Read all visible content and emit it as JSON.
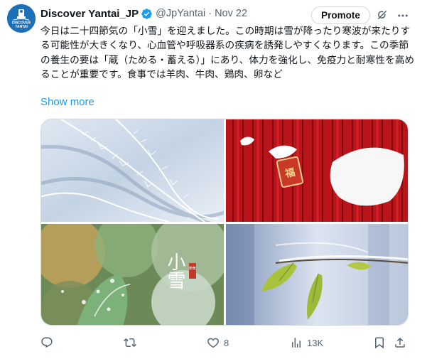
{
  "post": {
    "author_name": "Discover Yantai_JP",
    "handle": "@JpYantai",
    "separator": "·",
    "date": "Nov 22",
    "promote_label": "Promote",
    "avatar_text_top": "DISCOVER",
    "avatar_text_bottom": "YANTAI",
    "text": "今日は二十四節気の「小雪」を迎えました。この時期は雪が降ったり寒波が来たりする可能性が大きくなり、心血管や呼吸器系の疾病を誘発しやすくなります。この季節の養生の要は「蔵（ためる・蓄える）」にあり、体力を強化し、免疫力と耐寒性を高めることが重要です。食事では羊肉、牛肉、鶏肉、卵など",
    "show_more": "Show more",
    "image_caption": "小雪",
    "image_seal": "節気"
  },
  "actions": {
    "reply_count": "",
    "retweet_count": "",
    "like_count": "8",
    "views_count": "13K"
  },
  "icons": {
    "verified": "verified-badge-icon",
    "grok": "grok-icon",
    "more": "more-icon",
    "reply": "reply-icon",
    "retweet": "retweet-icon",
    "like": "heart-icon",
    "views": "views-icon",
    "bookmark": "bookmark-icon",
    "share": "share-icon"
  },
  "colors": {
    "link": "#1d9bf0",
    "secondary_text": "#536471",
    "primary_text": "#0f1419",
    "avatar_bg": "#1d6fb8"
  }
}
